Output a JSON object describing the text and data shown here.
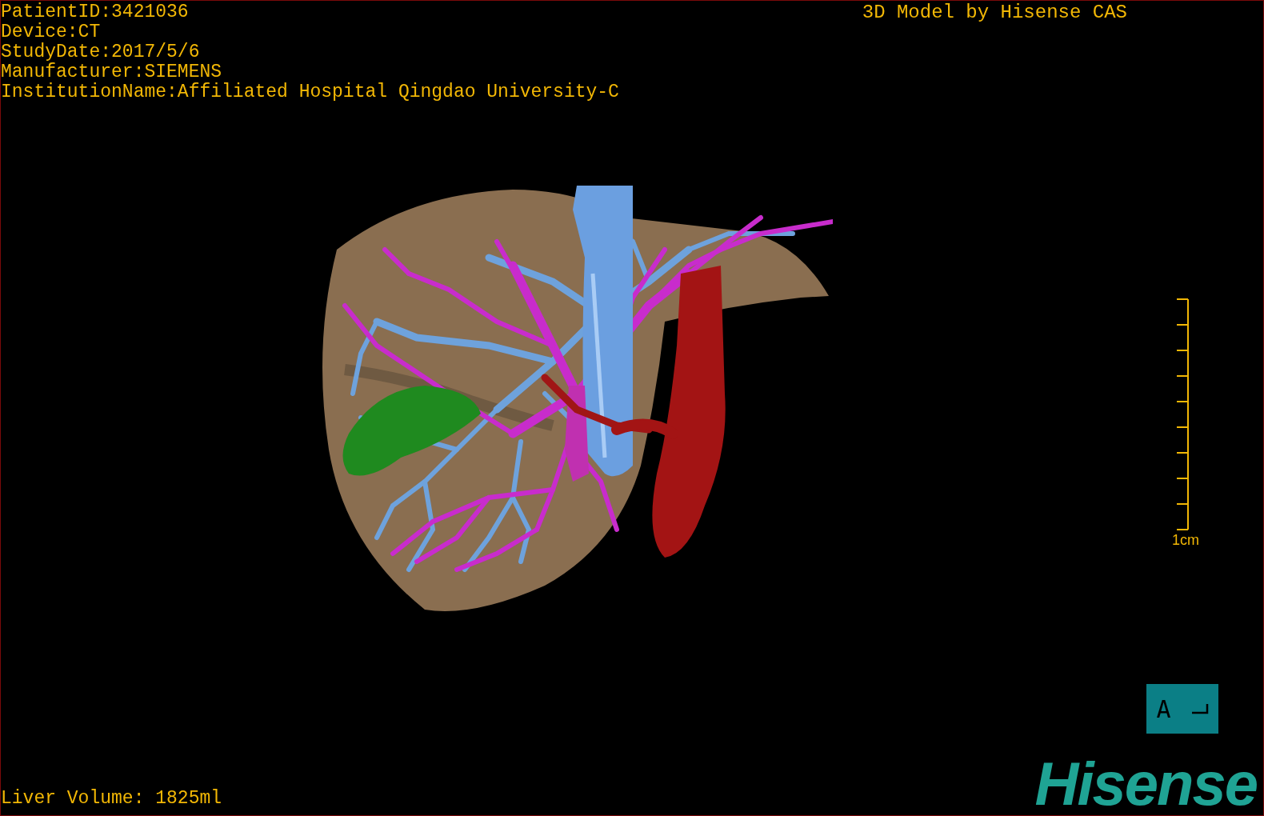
{
  "patient_info": [
    "PatientID:3421036",
    "Device:CT",
    "StudyDate:2017/5/6",
    "Manufacturer:SIEMENS",
    "InstitutionName:Affiliated Hospital Qingdao University-C"
  ],
  "title": "3D Model by Hisense CAS",
  "scale": {
    "label": "1cm"
  },
  "orientation": {
    "label": "A"
  },
  "liver_volume": "Liver Volume: 1825ml",
  "logo": "Hisense"
}
